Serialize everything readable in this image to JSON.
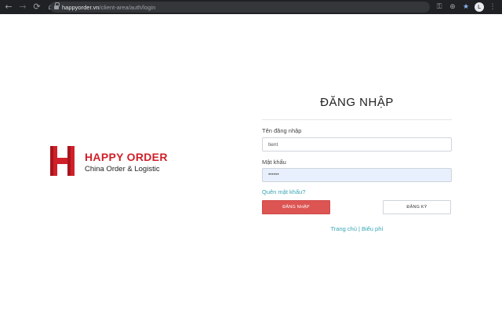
{
  "browser": {
    "url_host": "happyorder.vn",
    "url_path": "/client-area/auth/login",
    "back_icon": "←",
    "forward_icon": "→",
    "reload_icon": "⟳",
    "home_icon": "⌂",
    "key_icon": "⚿",
    "extension_icon": "⊕",
    "star_icon": "★",
    "avatar_letter": "L",
    "menu_icon": "⋮"
  },
  "brand": {
    "name": "HAPPY ORDER",
    "tagline": "China Order & Logistic",
    "color": "#d0202a"
  },
  "login": {
    "title": "ĐĂNG NHẬP",
    "username_label": "Tên đăng nhập",
    "username_value": "tient",
    "password_label": "Mật khẩu",
    "password_value": "••••••",
    "forgot_password": "Quên mật khẩu?",
    "login_button": "ĐĂNG NHẬP",
    "register_button": "ĐĂNG KÝ",
    "primary_color": "#dc5553",
    "link_color": "#37a5b5"
  },
  "footer_links": {
    "home": "Trang chủ",
    "separator": "|",
    "pricing": "Biểu phí"
  }
}
